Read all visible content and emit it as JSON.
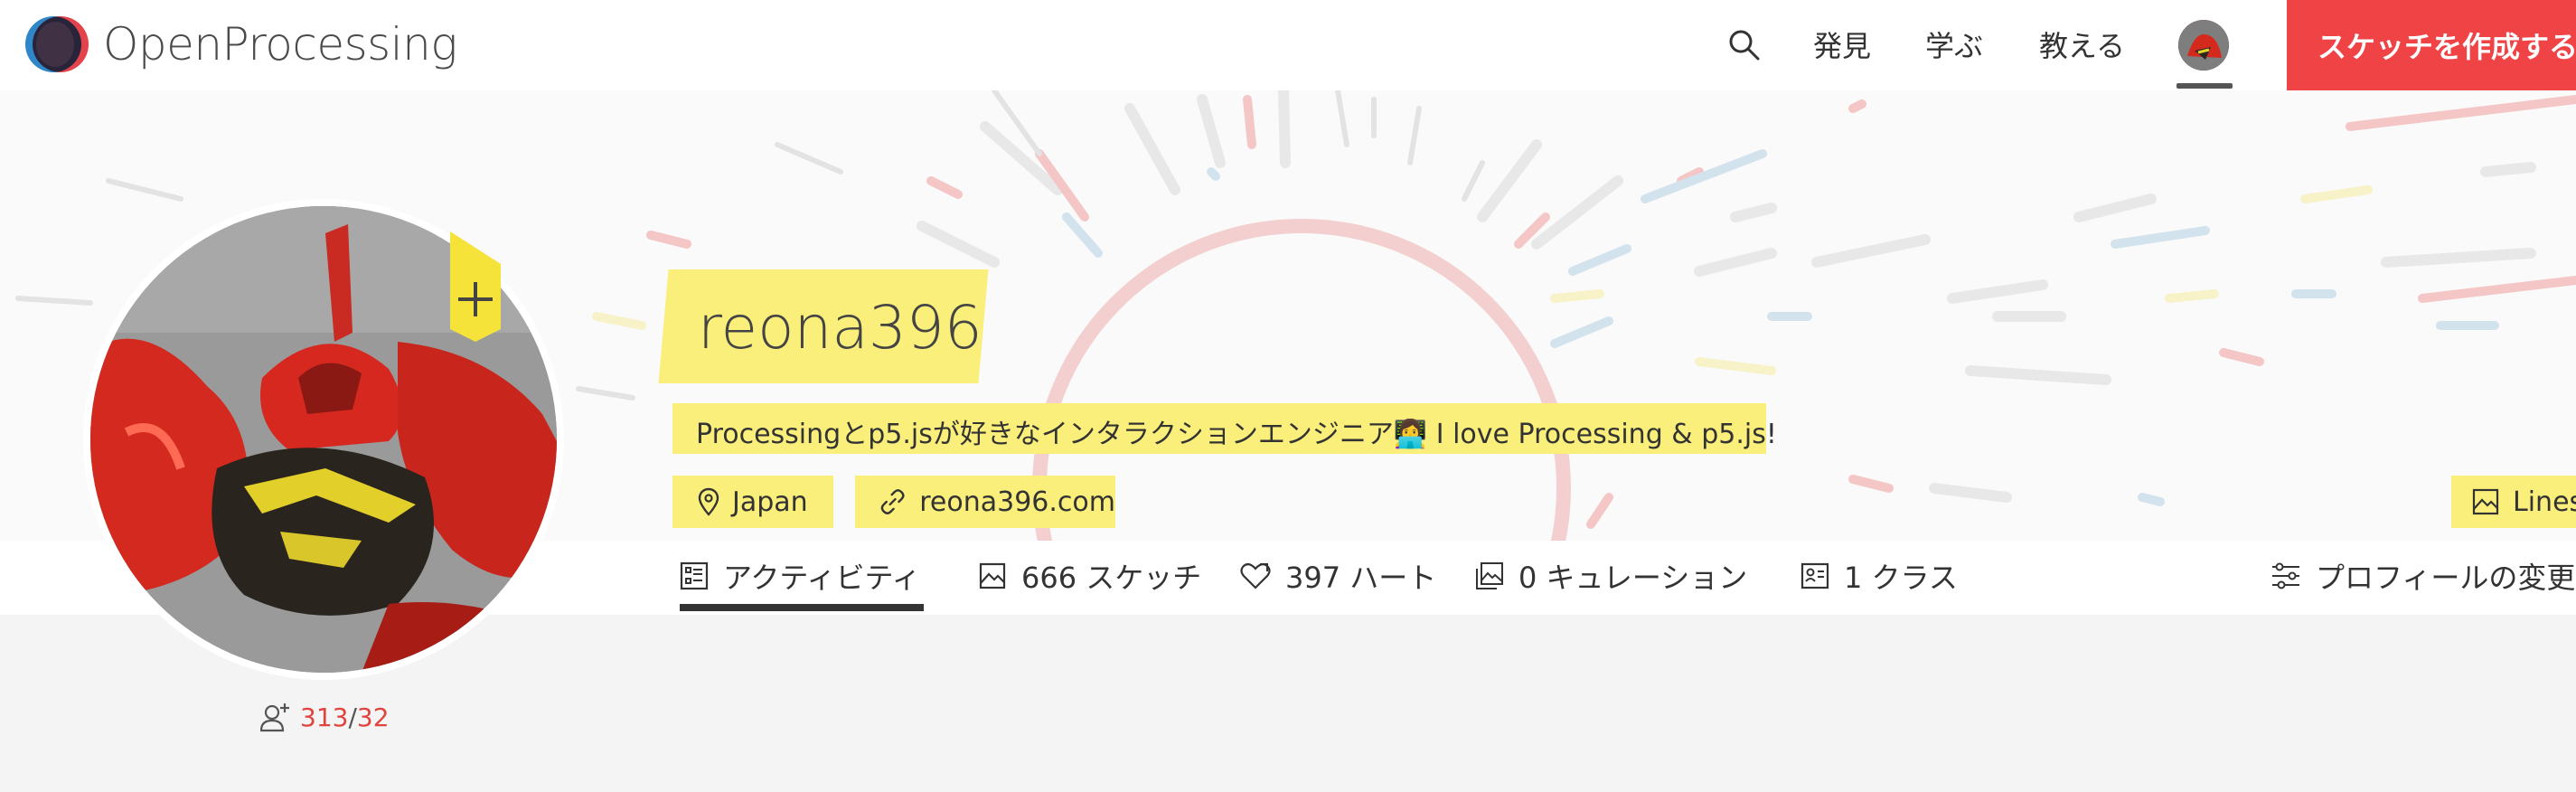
{
  "app": {
    "logo_text": "OpenProcessing"
  },
  "nav": {
    "search_icon": "search-icon",
    "links": [
      "発見",
      "学ぶ",
      "教える"
    ],
    "avatar_icon": "user-avatar",
    "create_sketch": "スケッチを作成する"
  },
  "profile": {
    "username": "reona396",
    "bio": "Processingとp5.jsが好きなインタラクションエンジニア👩‍💻 I love Processing & p5.js!",
    "location": "Japan",
    "website": "reona396.com",
    "pinned_label": "Lines",
    "follow": {
      "followers": "313",
      "separator": "/",
      "following": "32"
    }
  },
  "tabs": [
    {
      "label": "アクティビティ",
      "icon": "activity-icon",
      "active": true
    },
    {
      "label": "666 スケッチ",
      "icon": "sketch-icon",
      "active": false
    },
    {
      "label": "397 ハート",
      "icon": "heart-icon",
      "active": false
    },
    {
      "label": "0 キュレーション",
      "icon": "curation-icon",
      "active": false
    },
    {
      "label": "1 クラス",
      "icon": "class-icon",
      "active": false
    }
  ],
  "edit_profile": {
    "label": "プロフィールの変更",
    "icon": "sliders-icon"
  },
  "colors": {
    "accent_red": "#ef4346",
    "highlight_yellow": "#fbef7c",
    "count_red": "#e0443e"
  }
}
